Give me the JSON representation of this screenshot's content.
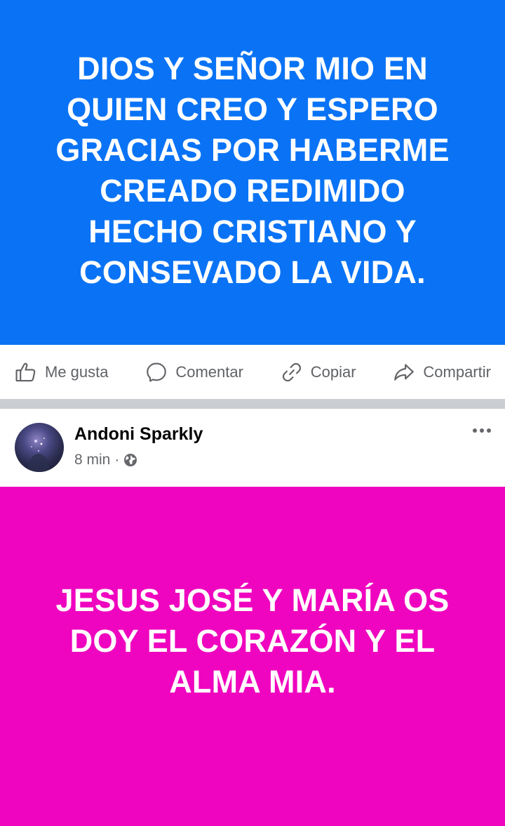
{
  "post1": {
    "text": "DIOS Y SEÑOR MIO EN\nQUIEN CREO Y ESPERO\nGRACIAS POR HABERME\nCREADO REDIMIDO\nHECHO CRISTIANO Y\nCONSEVADO LA VIDA.",
    "background_color": "#0a73f5"
  },
  "actions": {
    "like_label": "Me gusta",
    "comment_label": "Comentar",
    "copy_label": "Copiar",
    "share_label": "Compartir"
  },
  "post2": {
    "author": "Andoni Sparkly",
    "time": "8 min",
    "separator": "·",
    "privacy_icon": "globe-icon",
    "text": "JESUS JOSÉ Y MARÍA OS\nDOY EL CORAZÓN Y EL\nALMA MIA.",
    "background_color": "#ef05bf"
  },
  "icons": {
    "like": "thumbs-up-icon",
    "comment": "comment-bubble-icon",
    "copy": "link-icon",
    "share": "share-arrow-icon",
    "more": "more-options-icon"
  }
}
